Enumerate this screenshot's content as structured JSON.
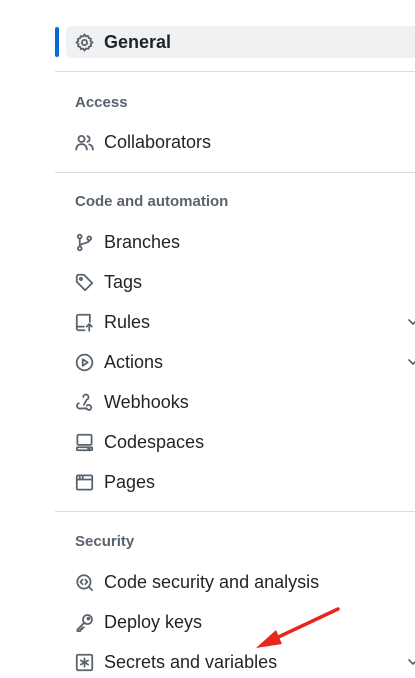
{
  "general": {
    "label": "General",
    "icon": "gear-icon",
    "active": true
  },
  "sections": {
    "access": {
      "title": "Access",
      "items": [
        {
          "label": "Collaborators",
          "icon": "people-icon"
        }
      ]
    },
    "code_automation": {
      "title": "Code and automation",
      "items": [
        {
          "label": "Branches",
          "icon": "git-branch-icon"
        },
        {
          "label": "Tags",
          "icon": "tag-icon"
        },
        {
          "label": "Rules",
          "icon": "repo-push-icon",
          "expandable": true
        },
        {
          "label": "Actions",
          "icon": "play-icon",
          "expandable": true
        },
        {
          "label": "Webhooks",
          "icon": "webhook-icon"
        },
        {
          "label": "Codespaces",
          "icon": "codespaces-icon"
        },
        {
          "label": "Pages",
          "icon": "browser-icon"
        }
      ]
    },
    "security": {
      "title": "Security",
      "items": [
        {
          "label": "Code security and analysis",
          "icon": "codescan-icon"
        },
        {
          "label": "Deploy keys",
          "icon": "key-icon"
        },
        {
          "label": "Secrets and variables",
          "icon": "asterisk-icon",
          "expandable": true
        }
      ]
    }
  },
  "colors": {
    "accent": "#0969da",
    "annotation_arrow": "#e8261c",
    "active_bg": "#f0f1f3"
  }
}
